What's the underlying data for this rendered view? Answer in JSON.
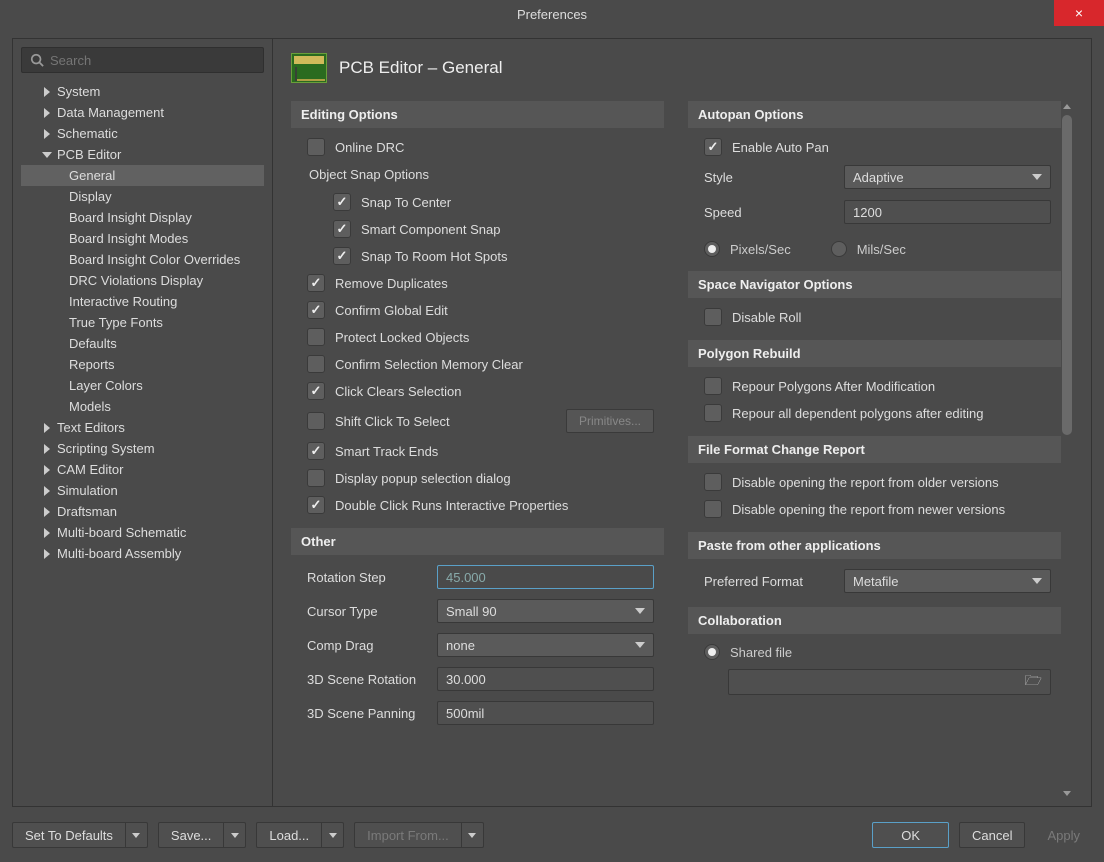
{
  "window": {
    "title": "Preferences",
    "close_icon": "×"
  },
  "search": {
    "placeholder": "Search"
  },
  "tree": {
    "items": [
      {
        "label": "System",
        "level": 1,
        "expanded": false,
        "selected": false
      },
      {
        "label": "Data Management",
        "level": 1,
        "expanded": false,
        "selected": false
      },
      {
        "label": "Schematic",
        "level": 1,
        "expanded": false,
        "selected": false
      },
      {
        "label": "PCB Editor",
        "level": 1,
        "expanded": true,
        "selected": false
      },
      {
        "label": "General",
        "level": 2,
        "selected": true
      },
      {
        "label": "Display",
        "level": 2,
        "selected": false
      },
      {
        "label": "Board Insight Display",
        "level": 2,
        "selected": false
      },
      {
        "label": "Board Insight Modes",
        "level": 2,
        "selected": false
      },
      {
        "label": "Board Insight Color Overrides",
        "level": 2,
        "selected": false
      },
      {
        "label": "DRC Violations Display",
        "level": 2,
        "selected": false
      },
      {
        "label": "Interactive Routing",
        "level": 2,
        "selected": false
      },
      {
        "label": "True Type Fonts",
        "level": 2,
        "selected": false
      },
      {
        "label": "Defaults",
        "level": 2,
        "selected": false
      },
      {
        "label": "Reports",
        "level": 2,
        "selected": false
      },
      {
        "label": "Layer Colors",
        "level": 2,
        "selected": false
      },
      {
        "label": "Models",
        "level": 2,
        "selected": false
      },
      {
        "label": "Text Editors",
        "level": 1,
        "expanded": false,
        "selected": false
      },
      {
        "label": "Scripting System",
        "level": 1,
        "expanded": false,
        "selected": false
      },
      {
        "label": "CAM Editor",
        "level": 1,
        "expanded": false,
        "selected": false
      },
      {
        "label": "Simulation",
        "level": 1,
        "expanded": false,
        "selected": false
      },
      {
        "label": "Draftsman",
        "level": 1,
        "expanded": false,
        "selected": false
      },
      {
        "label": "Multi-board Schematic",
        "level": 1,
        "expanded": false,
        "selected": false
      },
      {
        "label": "Multi-board Assembly",
        "level": 1,
        "expanded": false,
        "selected": false
      }
    ]
  },
  "page": {
    "title": "PCB Editor – General"
  },
  "editing": {
    "header": "Editing Options",
    "online_drc": {
      "label": "Online DRC",
      "checked": false
    },
    "snap_header": "Object Snap Options",
    "snap_center": {
      "label": "Snap To Center",
      "checked": true
    },
    "smart_component_snap": {
      "label": "Smart Component Snap",
      "checked": true
    },
    "snap_room": {
      "label": "Snap To Room Hot Spots",
      "checked": true
    },
    "remove_dupes": {
      "label": "Remove Duplicates",
      "checked": true
    },
    "confirm_global": {
      "label": "Confirm Global Edit",
      "checked": true
    },
    "protect_locked": {
      "label": "Protect Locked Objects",
      "checked": false
    },
    "confirm_selmem": {
      "label": "Confirm Selection Memory Clear",
      "checked": false
    },
    "click_clears": {
      "label": "Click Clears Selection",
      "checked": true
    },
    "shift_click": {
      "label": "Shift Click To Select",
      "checked": false
    },
    "primitives_btn": "Primitives...",
    "smart_track_ends": {
      "label": "Smart Track Ends",
      "checked": true
    },
    "popup_sel": {
      "label": "Display popup selection dialog",
      "checked": false
    },
    "dblclick_props": {
      "label": "Double Click Runs Interactive Properties",
      "checked": true
    }
  },
  "other": {
    "header": "Other",
    "rotation_step": {
      "label": "Rotation Step",
      "value": "45.000"
    },
    "cursor_type": {
      "label": "Cursor Type",
      "value": "Small 90"
    },
    "comp_drag": {
      "label": "Comp Drag",
      "value": "none"
    },
    "scene_rotation": {
      "label": "3D Scene Rotation",
      "value": "30.000"
    },
    "scene_panning": {
      "label": "3D Scene Panning",
      "value": "500mil"
    }
  },
  "autopan": {
    "header": "Autopan Options",
    "enable": {
      "label": "Enable Auto Pan",
      "checked": true
    },
    "style": {
      "label": "Style",
      "value": "Adaptive"
    },
    "speed": {
      "label": "Speed",
      "value": "1200"
    },
    "units": {
      "pixels": "Pixels/Sec",
      "mils": "Mils/Sec",
      "selected": "pixels"
    }
  },
  "spacenav": {
    "header": "Space Navigator Options",
    "disable_roll": {
      "label": "Disable Roll",
      "checked": false
    }
  },
  "polyrebuild": {
    "header": "Polygon Rebuild",
    "repour_mod": {
      "label": "Repour Polygons After Modification",
      "checked": false
    },
    "repour_dep": {
      "label": "Repour all dependent polygons after editing",
      "checked": false
    }
  },
  "fileformat": {
    "header": "File Format Change Report",
    "older": {
      "label": "Disable opening the report from older versions",
      "checked": false
    },
    "newer": {
      "label": "Disable opening the report from newer versions",
      "checked": false
    }
  },
  "paste": {
    "header": "Paste from other applications",
    "pref_format": {
      "label": "Preferred Format",
      "value": "Metafile"
    }
  },
  "collab": {
    "header": "Collaboration",
    "shared_file": {
      "label": "Shared file",
      "selected": true
    }
  },
  "footer": {
    "defaults": "Set To Defaults",
    "save": "Save...",
    "load": "Load...",
    "import": "Import From...",
    "ok": "OK",
    "cancel": "Cancel",
    "apply": "Apply"
  }
}
